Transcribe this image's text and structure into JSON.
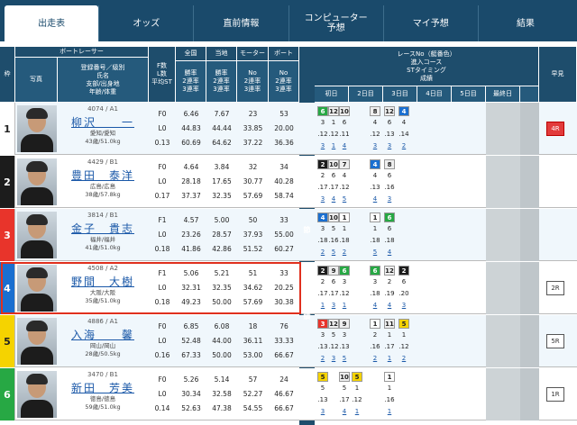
{
  "tabs": [
    {
      "label": "出走表"
    },
    {
      "label": "オッズ"
    },
    {
      "label": "直前情報"
    },
    {
      "label": "コンピューター\n予想"
    },
    {
      "label": "マイ予想"
    },
    {
      "label": "結果"
    }
  ],
  "headers": {
    "waku": "枠",
    "photo": "写真",
    "info": "登録番号／級別\n氏名\n支部/出身地\n年齢/体重",
    "boat_racer": "ボートレーサー",
    "st": "F数\nL数\n平均ST",
    "zenkoku": "全国",
    "touchi": "当地",
    "motor": "モーター",
    "boat": "ボート",
    "rate_col": "勝率\n2連率\n3連率",
    "mb_col": "No\n2連率\n3連率",
    "recent": "レースNo（艇番色）\n進入コース\nSTタイミング\n成績",
    "hayami": "早見",
    "days": [
      "初日",
      "2日目",
      "3日目",
      "4日目",
      "5日目",
      "最終日"
    ],
    "vertical": "今節成績"
  },
  "racers": [
    {
      "waku": "1",
      "reg": "4074 / A1",
      "name": "柳沢　　一",
      "branch": "愛知/愛知",
      "agewt": "43歳/51.0kg",
      "f": "F0",
      "l": "L0",
      "st": "0.13",
      "zr": [
        "6.46",
        "44.83",
        "60.69"
      ],
      "tr": [
        "7.67",
        "44.44",
        "64.62"
      ],
      "mo": [
        "23",
        "33.85",
        "37.22"
      ],
      "bo": [
        "53",
        "20.00",
        "36.36"
      ],
      "hayami": "4R",
      "cells": [
        [
          "6",
          "12",
          "10",
          "",
          "8",
          "12",
          "4"
        ],
        [
          "3",
          "1",
          "6",
          "",
          "4",
          "6",
          "4"
        ],
        [
          ".12",
          ".12",
          ".11",
          "",
          ".12",
          ".13",
          ".14"
        ],
        [
          "3",
          "1",
          "4",
          "",
          "3",
          "3",
          "2"
        ]
      ]
    },
    {
      "waku": "2",
      "reg": "4429 / B1",
      "name": "豊田　泰洋",
      "branch": "広島/広島",
      "agewt": "38歳/57.8kg",
      "f": "F0",
      "l": "L0",
      "st": "0.17",
      "zr": [
        "4.64",
        "28.18",
        "37.37"
      ],
      "tr": [
        "3.84",
        "17.65",
        "32.35"
      ],
      "mo": [
        "32",
        "30.77",
        "57.69"
      ],
      "bo": [
        "34",
        "40.28",
        "58.74"
      ],
      "hayami": "",
      "cells": [
        [
          "2",
          "10",
          "7",
          "",
          "4",
          "8",
          ""
        ],
        [
          "2",
          "6",
          "4",
          "",
          "4",
          "6",
          ""
        ],
        [
          ".17",
          ".17",
          ".12",
          "",
          ".13",
          ".16",
          ""
        ],
        [
          "3",
          "4",
          "5",
          "",
          "4",
          "3",
          ""
        ]
      ]
    },
    {
      "waku": "3",
      "reg": "3814 / B1",
      "name": "金子　貴志",
      "branch": "福井/福井",
      "agewt": "41歳/51.0kg",
      "f": "F1",
      "l": "L0",
      "st": "0.18",
      "zr": [
        "4.57",
        "23.26",
        "41.86"
      ],
      "tr": [
        "5.00",
        "28.57",
        "42.86"
      ],
      "mo": [
        "50",
        "37.93",
        "51.52"
      ],
      "bo": [
        "33",
        "55.00",
        "60.27"
      ],
      "hayami": "",
      "cells": [
        [
          "4",
          "10",
          "1",
          "",
          "1",
          "6",
          ""
        ],
        [
          "3",
          "5",
          "1",
          "",
          "1",
          "6",
          ""
        ],
        [
          ".18",
          ".16",
          ".18",
          "",
          ".18",
          ".18",
          ""
        ],
        [
          "2",
          "5",
          "2",
          "",
          "5",
          "4",
          ""
        ]
      ]
    },
    {
      "waku": "4",
      "reg": "4508 / A2",
      "name": "野間　大樹",
      "branch": "大阪/大阪",
      "agewt": "35歳/51.0kg",
      "f": "F1",
      "l": "L0",
      "st": "0.18",
      "zr": [
        "5.06",
        "32.31",
        "49.23"
      ],
      "tr": [
        "5.21",
        "32.35",
        "50.00"
      ],
      "mo": [
        "51",
        "34.62",
        "57.69"
      ],
      "bo": [
        "33",
        "20.25",
        "30.38"
      ],
      "hayami": "2R",
      "cells": [
        [
          "2",
          "9",
          "6",
          "",
          "6",
          "12",
          "2"
        ],
        [
          "2",
          "6",
          "3",
          "",
          "3",
          "2",
          "6"
        ],
        [
          ".17",
          ".17",
          ".12",
          "",
          ".18",
          ".19",
          ".20"
        ],
        [
          "1",
          "3",
          "1",
          "",
          "4",
          "4",
          "3"
        ]
      ]
    },
    {
      "waku": "5",
      "reg": "4886 / A1",
      "name": "入海　　馨",
      "branch": "岡山/岡山",
      "agewt": "28歳/50.5kg",
      "f": "F0",
      "l": "L0",
      "st": "0.16",
      "zr": [
        "6.85",
        "52.48",
        "67.33"
      ],
      "tr": [
        "6.08",
        "44.00",
        "50.00"
      ],
      "mo": [
        "18",
        "36.11",
        "53.00"
      ],
      "bo": [
        "76",
        "33.33",
        "66.67"
      ],
      "hayami": "5R",
      "cells": [
        [
          "3",
          "12",
          "9",
          "",
          "1",
          "11",
          "5"
        ],
        [
          "3",
          "5",
          "3",
          "",
          "2",
          "1",
          "1"
        ],
        [
          ".13",
          ".12",
          ".13",
          "",
          ".16",
          ".17",
          ".12"
        ],
        [
          "2",
          "3",
          "5",
          "",
          "2",
          "1",
          "2"
        ]
      ]
    },
    {
      "waku": "6",
      "reg": "3470 / B1",
      "name": "新田　芳美",
      "branch": "徳島/徳島",
      "agewt": "59歳/51.0kg",
      "f": "F0",
      "l": "L0",
      "st": "0.14",
      "zr": [
        "5.26",
        "30.34",
        "52.63"
      ],
      "tr": [
        "5.14",
        "32.58",
        "47.38"
      ],
      "mo": [
        "57",
        "52.27",
        "54.55"
      ],
      "bo": [
        "24",
        "46.67",
        "66.67"
      ],
      "hayami": "1R",
      "cells": [
        [
          "5",
          "",
          "10",
          "5",
          "",
          "1",
          ""
        ],
        [
          "5",
          "",
          "5",
          "1",
          "",
          "1",
          ""
        ],
        [
          ".13",
          "",
          ".17",
          ".12",
          "",
          ".16",
          ""
        ],
        [
          "3",
          "",
          "4",
          "1",
          "",
          "1",
          ""
        ]
      ]
    }
  ],
  "colors": {
    "w1": "#ffffff",
    "w2": "#1c1c1c",
    "w3": "#e8342b",
    "w4": "#1a6fd0",
    "w5": "#f5d300",
    "w6": "#27a844"
  }
}
